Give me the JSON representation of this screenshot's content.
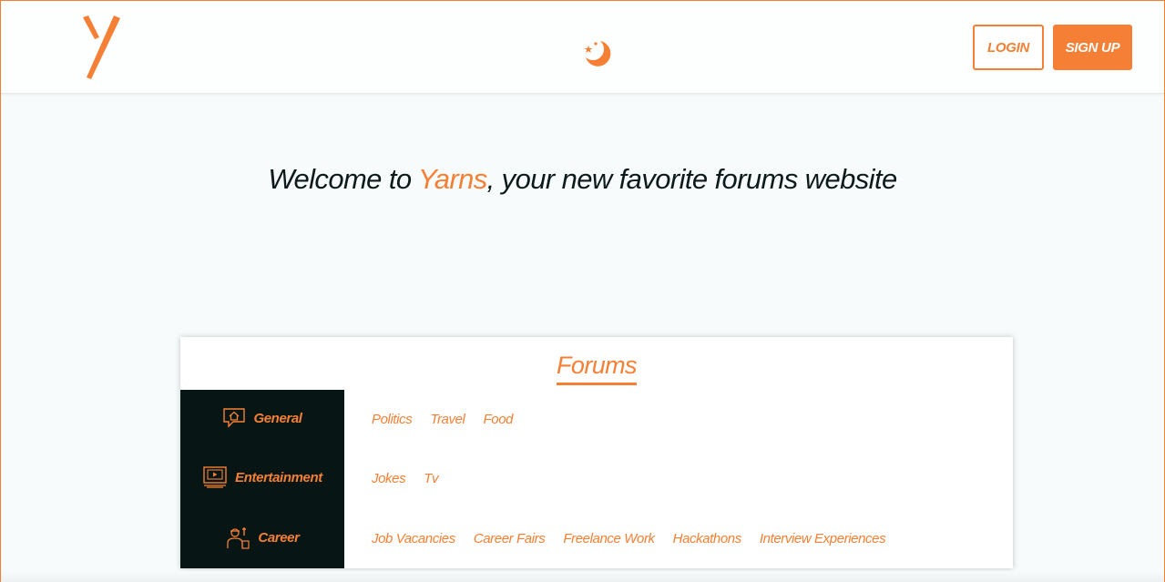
{
  "header": {
    "logo_icon": "yarns-y-logo",
    "theme_toggle_icon": "moon-stars-icon",
    "login_label": "LOGIN",
    "signup_label": "SIGN UP"
  },
  "hero": {
    "prefix": "Welcome to ",
    "brand": "Yarns",
    "suffix": ", your new favorite forums website"
  },
  "forums": {
    "title": "Forums",
    "categories": [
      {
        "icon": "chat-home-icon",
        "label": "General",
        "subforums": [
          "Politics",
          "Travel",
          "Food"
        ]
      },
      {
        "icon": "video-player-icon",
        "label": "Entertainment",
        "subforums": [
          "Jokes",
          "Tv"
        ]
      },
      {
        "icon": "worker-icon",
        "label": "Career",
        "subforums": [
          "Job Vacancies",
          "Career Fairs",
          "Freelance Work",
          "Hackathons",
          "Interview Experiences"
        ]
      }
    ]
  },
  "colors": {
    "accent": "#f58035",
    "dark_panel": "#071615",
    "text": "#0d1a1a"
  }
}
